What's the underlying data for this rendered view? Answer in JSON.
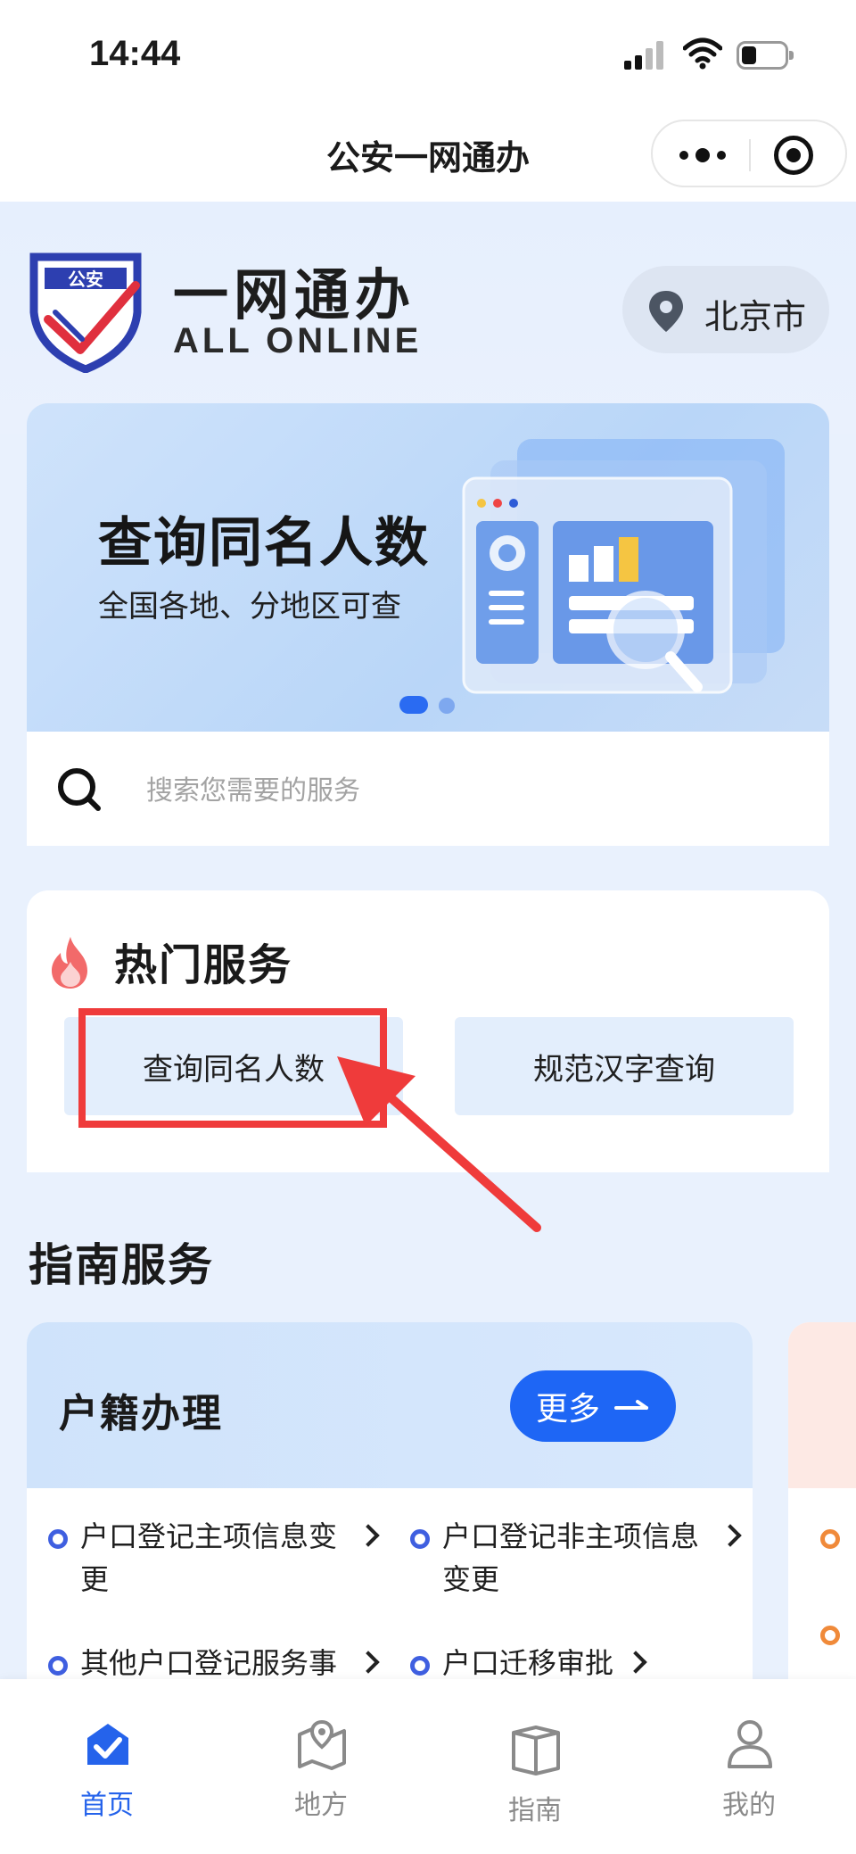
{
  "status_bar": {
    "time": "14:44"
  },
  "nav": {
    "title": "公安一网通办"
  },
  "header": {
    "logo_badge": "公安",
    "logo_cn": "一网通办",
    "logo_en": "ALL ONLINE",
    "city": "北京市"
  },
  "banner": {
    "title": "查询同名人数",
    "subtitle": "全国各地、分地区可查",
    "page_index": 1,
    "page_count": 2
  },
  "search": {
    "placeholder": "搜索您需要的服务"
  },
  "hot_services": {
    "title": "热门服务",
    "items": [
      {
        "label": "查询同名人数"
      },
      {
        "label": "规范汉字查询"
      }
    ]
  },
  "guide": {
    "title": "指南服务",
    "card": {
      "title": "户籍办理",
      "more_label": "更多",
      "items": [
        {
          "line1": "户口登记主项信息变",
          "line2": "更"
        },
        {
          "line1": "户口登记非主项信息",
          "line2": "变更"
        },
        {
          "line1": "其他户口登记服务事",
          "line2": ""
        },
        {
          "line1": "户口迁移审批",
          "line2": ""
        }
      ]
    }
  },
  "tab_bar": {
    "tabs": [
      {
        "label": "首页"
      },
      {
        "label": "地方"
      },
      {
        "label": "指南"
      },
      {
        "label": "我的"
      }
    ]
  },
  "colors": {
    "accent": "#1e66f5",
    "annotation": "#ef3b3b",
    "background": "#e9f1fd"
  }
}
